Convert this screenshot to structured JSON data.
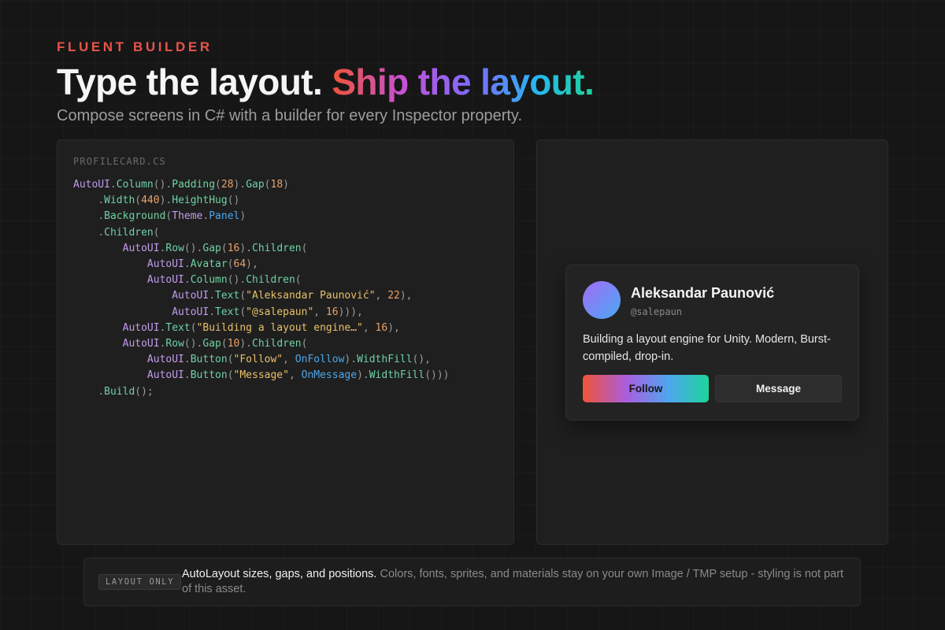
{
  "header": {
    "eyebrow": "FLUENT BUILDER",
    "headline_plain": "Type the layout.",
    "headline_gradient": "Ship the layout.",
    "subtitle": "Compose screens in C# with a builder for every Inspector property."
  },
  "code_panel": {
    "filename": "PROFILECARD.CS"
  },
  "preview": {
    "name": "Aleksandar Paunović",
    "handle": "@salepaun",
    "bio": "Building a layout engine for Unity. Modern, Burst-compiled, drop-in.",
    "follow_label": "Follow",
    "message_label": "Message"
  },
  "note": {
    "badge": "LAYOUT ONLY",
    "lead": "AutoLayout sizes, gaps, and positions.",
    "rest": "Colors, fonts, sprites, and materials stay on your own Image / TMP setup - styling is not part of this asset."
  },
  "colors": {
    "background": "#161616",
    "accent_red": "#ef5437",
    "accent_purple": "#a95ee0",
    "accent_blue": "#4fa6f0",
    "accent_green": "#1ed49a"
  }
}
